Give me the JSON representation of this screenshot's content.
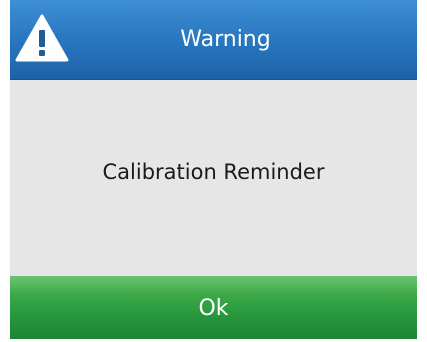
{
  "dialog": {
    "title": "Warning",
    "icon": "warning-triangle-icon",
    "message": "Calibration Reminder",
    "ok_label": "Ok"
  },
  "colors": {
    "title_bar": "#2a79c2",
    "body_background": "#e6e6e6",
    "ok_button": "#2f9c40",
    "title_text": "#ffffff",
    "message_text": "#1a1a1a"
  }
}
